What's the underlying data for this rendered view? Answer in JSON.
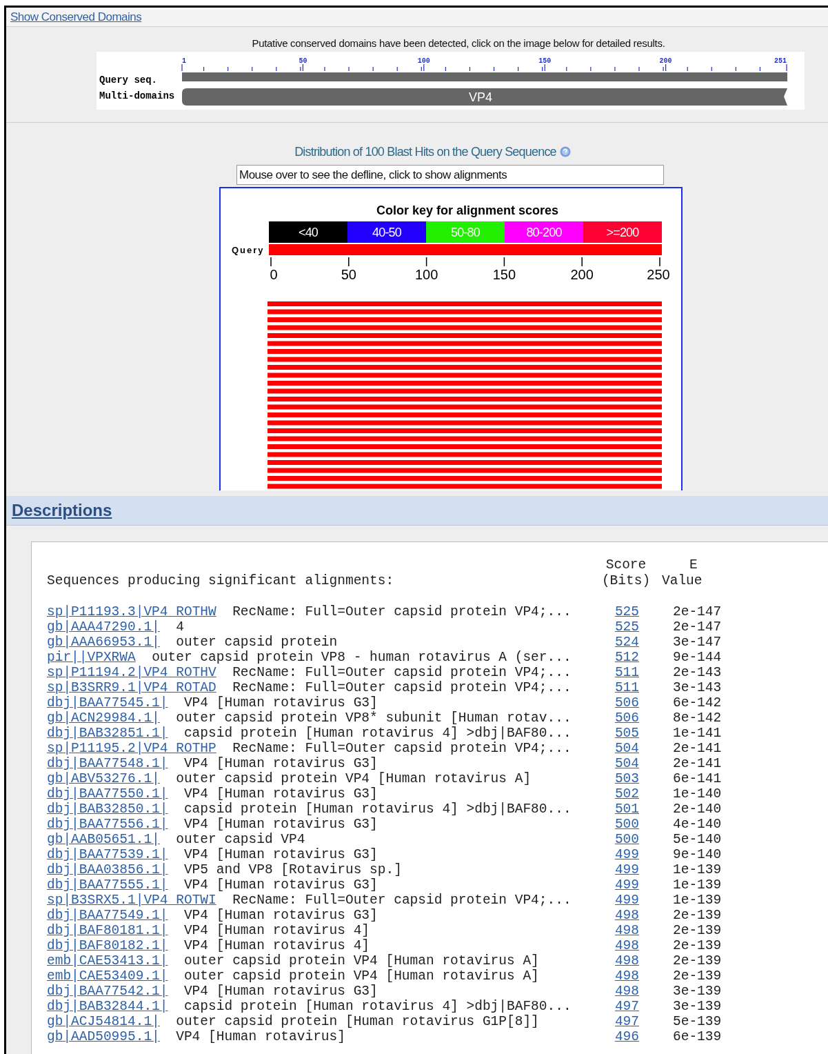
{
  "conserved_domains_link": "Show Conserved Domains",
  "domains": {
    "message": "Putative conserved domains have been detected, click on the image below for detailed results.",
    "row_labels": [
      "Query seq.",
      "Multi-domains"
    ],
    "ruler_ticks": [
      "1",
      "50",
      "100",
      "150",
      "200",
      "251"
    ],
    "domain": "VP4"
  },
  "distribution": {
    "title": "Distribution of 100 Blast Hits on the Query Sequence",
    "defline_field": {
      "value": "Mouse over to see the defline, click to show alignments"
    },
    "color_key": {
      "title": "Color key for alignment scores",
      "bins": [
        {
          "label": "<40",
          "color": "#000000"
        },
        {
          "label": "40-50",
          "color": "#2200ff"
        },
        {
          "label": "50-80",
          "color": "#22ee00"
        },
        {
          "label": "80-200",
          "color": "#ff00ff"
        },
        {
          "label": ">=200",
          "color": "#ff0033"
        }
      ],
      "query_label": "Query",
      "axis_ticks": [
        "0",
        "50",
        "100",
        "150",
        "200",
        "250"
      ]
    },
    "hits": [
      {
        "color": "#ff0000"
      },
      {
        "color": "#ff0000"
      },
      {
        "color": "#ff0000"
      },
      {
        "color": "#ff0000"
      },
      {
        "color": "#ff0000"
      },
      {
        "color": "#ff0000"
      },
      {
        "color": "#ff0000"
      },
      {
        "color": "#ff0000"
      },
      {
        "color": "#ff0000"
      },
      {
        "color": "#ff0000"
      },
      {
        "color": "#ff0000"
      },
      {
        "color": "#ff0000"
      },
      {
        "color": "#ff0000"
      },
      {
        "color": "#ff0000"
      },
      {
        "color": "#ff0000"
      },
      {
        "color": "#ff0000"
      },
      {
        "color": "#ff0000"
      },
      {
        "color": "#ff0000"
      },
      {
        "color": "#ff0000"
      },
      {
        "color": "#ff0000"
      },
      {
        "color": "#ff0000"
      },
      {
        "color": "#ff0000"
      },
      {
        "color": "#ff0000"
      },
      {
        "color": "#ff0000"
      }
    ]
  },
  "descriptions": {
    "title": "Descriptions",
    "heading": "Sequences producing significant alignments:",
    "score_header": [
      "Score",
      "(Bits)"
    ],
    "evalue_header": [
      "E",
      "Value"
    ],
    "rows": [
      {
        "accession": "sp|P11193.3|VP4_ROTHW",
        "description": "RecName: Full=Outer capsid protein VP4;...",
        "score": "525",
        "evalue": "2e-147"
      },
      {
        "accession": "gb|AAA47290.1|",
        "description": "4",
        "score": "525",
        "evalue": "2e-147"
      },
      {
        "accession": "gb|AAA66953.1|",
        "description": "outer capsid protein",
        "score": "524",
        "evalue": "3e-147"
      },
      {
        "accession": "pir||VPXRWA",
        "description": "outer capsid protein VP8 - human rotavirus A (ser...",
        "score": "512",
        "evalue": "9e-144"
      },
      {
        "accession": "sp|P11194.2|VP4_ROTHV",
        "description": "RecName: Full=Outer capsid protein VP4;...",
        "score": "511",
        "evalue": "2e-143"
      },
      {
        "accession": "sp|B3SRR9.1|VP4_ROTAD",
        "description": "RecName: Full=Outer capsid protein VP4;...",
        "score": "511",
        "evalue": "3e-143"
      },
      {
        "accession": "dbj|BAA77545.1|",
        "description": "VP4 [Human rotavirus G3]",
        "score": "506",
        "evalue": "6e-142"
      },
      {
        "accession": "gb|ACN29984.1|",
        "description": "outer capsid protein VP8* subunit [Human rotav...",
        "score": "506",
        "evalue": "8e-142"
      },
      {
        "accession": "dbj|BAB32851.1|",
        "description": "capsid protein [Human rotavirus 4] >dbj|BAF80...",
        "score": "505",
        "evalue": "1e-141"
      },
      {
        "accession": "sp|P11195.2|VP4_ROTHP",
        "description": "RecName: Full=Outer capsid protein VP4;...",
        "score": "504",
        "evalue": "2e-141"
      },
      {
        "accession": "dbj|BAA77548.1|",
        "description": "VP4 [Human rotavirus G3]",
        "score": "504",
        "evalue": "2e-141"
      },
      {
        "accession": "gb|ABV53276.1|",
        "description": "outer capsid protein VP4 [Human rotavirus A]",
        "score": "503",
        "evalue": "6e-141"
      },
      {
        "accession": "dbj|BAA77550.1|",
        "description": "VP4 [Human rotavirus G3]",
        "score": "502",
        "evalue": "1e-140"
      },
      {
        "accession": "dbj|BAB32850.1|",
        "description": "capsid protein [Human rotavirus 4] >dbj|BAF80...",
        "score": "501",
        "evalue": "2e-140"
      },
      {
        "accession": "dbj|BAA77556.1|",
        "description": "VP4 [Human rotavirus G3]",
        "score": "500",
        "evalue": "4e-140"
      },
      {
        "accession": "gb|AAB05651.1|",
        "description": "outer capsid VP4",
        "score": "500",
        "evalue": "5e-140"
      },
      {
        "accession": "dbj|BAA77539.1|",
        "description": "VP4 [Human rotavirus G3]",
        "score": "499",
        "evalue": "9e-140"
      },
      {
        "accession": "dbj|BAA03856.1|",
        "description": "VP5 and VP8 [Rotavirus sp.]",
        "score": "499",
        "evalue": "1e-139"
      },
      {
        "accession": "dbj|BAA77555.1|",
        "description": "VP4 [Human rotavirus G3]",
        "score": "499",
        "evalue": "1e-139"
      },
      {
        "accession": "sp|B3SRX5.1|VP4_ROTWI",
        "description": "RecName: Full=Outer capsid protein VP4;...",
        "score": "499",
        "evalue": "1e-139"
      },
      {
        "accession": "dbj|BAA77549.1|",
        "description": "VP4 [Human rotavirus G3]",
        "score": "498",
        "evalue": "2e-139"
      },
      {
        "accession": "dbj|BAF80181.1|",
        "description": "VP4 [Human rotavirus 4]",
        "score": "498",
        "evalue": "2e-139"
      },
      {
        "accession": "dbj|BAF80182.1|",
        "description": "VP4 [Human rotavirus 4]",
        "score": "498",
        "evalue": "2e-139"
      },
      {
        "accession": "emb|CAE53413.1|",
        "description": "outer capsid protein VP4 [Human rotavirus A]",
        "score": "498",
        "evalue": "2e-139"
      },
      {
        "accession": "emb|CAE53409.1|",
        "description": "outer capsid protein VP4 [Human rotavirus A]",
        "score": "498",
        "evalue": "2e-139"
      },
      {
        "accession": "dbj|BAA77542.1|",
        "description": "VP4 [Human rotavirus G3]",
        "score": "498",
        "evalue": "3e-139"
      },
      {
        "accession": "dbj|BAB32844.1|",
        "description": "capsid protein [Human rotavirus 4] >dbj|BAF80...",
        "score": "497",
        "evalue": "3e-139"
      },
      {
        "accession": "gb|ACJ54814.1|",
        "description": "outer capsid protein [Human rotavirus G1P[8]]",
        "score": "497",
        "evalue": "5e-139"
      },
      {
        "accession": "gb|AAD50995.1|",
        "description": "VP4 [Human rotavirus]",
        "score": "496",
        "evalue": "6e-139"
      }
    ]
  }
}
